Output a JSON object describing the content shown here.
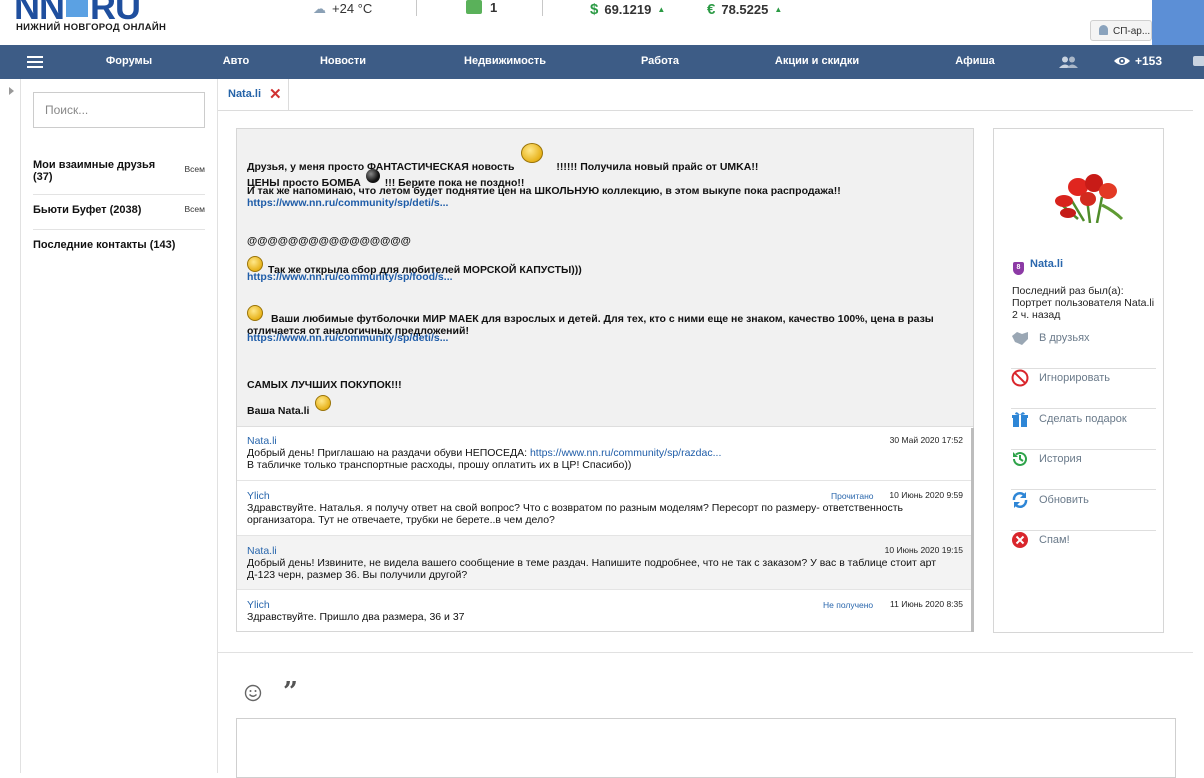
{
  "header": {
    "logo_main": "NN",
    "logo_tld": "RU",
    "logo_sub": "НИЖНИЙ НОВГОРОД ОНЛАЙН",
    "weather": "+24 °C",
    "notifications_count": "1",
    "usd": {
      "symbol": "$",
      "value": "69.1219"
    },
    "eur": {
      "symbol": "€",
      "value": "78.5225"
    },
    "user_button": "СП-ар..."
  },
  "nav": {
    "items": [
      "Форумы",
      "Авто",
      "Новости",
      "Недвижимость",
      "Работа",
      "Акции и скидки",
      "Афиша"
    ],
    "views": "+153"
  },
  "sidebar": {
    "search_placeholder": "Поиск...",
    "groups": [
      {
        "label": "Мои взаимные друзья (37)",
        "all": "Всем"
      },
      {
        "label": "Бьюти Буфет (2038)",
        "all": "Всем"
      },
      {
        "label": "Последние контакты (143)",
        "all": ""
      }
    ]
  },
  "tab": {
    "title": "Nata.li",
    "close": "✕"
  },
  "first_message": {
    "p1_a": "Друзья, у меня просто ФАНТАСТИЧЕСКАЯ новость",
    "p1_b": "!!!!!! Получила новый прайс от UMKA!!",
    "p2_a": "ЦЕНЫ просто БОМБА",
    "p2_b": "!!! Берите пока не поздно!!",
    "p3": "И так же напоминаю, что летом будет поднятие цен на ШКОЛЬНУЮ коллекцию, в этом выкупе пока распродажа!!",
    "link1": "https://www.nn.ru/community/sp/deti/s...",
    "ats": "@@@@@@@@@@@@@@@@",
    "p4": "Так же открыла сбор для любителей МОРСКОЙ КАПУСТЫ)))",
    "link2": "https://www.nn.ru/community/sp/food/s...",
    "p5": "Ваши любимые футболочки МИР МАЕК для взрослых и детей. Для тех, кто с ними еще не знаком, качество 100%, цена в разы отличается от аналогичных предложений!",
    "link3": "https://www.nn.ru/community/sp/deti/s...",
    "p6": "САМЫХ ЛУЧШИХ ПОКУПОК!!!",
    "p7": "Ваша Nata.li"
  },
  "replies": [
    {
      "author": "Nata.li",
      "status": "",
      "date": "30 Май 2020 17:52",
      "text_a": "Добрый день! Приглашаю на раздачи обуви НЕПОСЕДА: ",
      "link": "https://www.nn.ru/community/sp/razdac...",
      "text_b": "В табличке только транспортные расходы, прошу оплатить их в ЦР! Спасибо))"
    },
    {
      "author": "Ylich",
      "status": "Прочитано",
      "date": "10 Июнь 2020 9:59",
      "text_a": "Здравствуйте. Наталья. я получу ответ на свой вопрос? Что с возвратом по разным моделям? Пересорт по размеру- ответственность организатора. Тут не отвечаете, трубки не берете..в чем дело?",
      "link": "",
      "text_b": ""
    },
    {
      "author": "Nata.li",
      "status": "",
      "date": "10 Июнь 2020 19:15",
      "text_a": "Добрый день! Извините, не видела вашего сообщение в теме раздач. Напишите подробнее, что не так с заказом? У вас в таблице стоит арт Д-123 черн, размер 36. Вы получили другой?",
      "link": "",
      "text_b": ""
    },
    {
      "author": "Ylich",
      "status": "Не получено",
      "date": "11 Июнь 2020 8:35",
      "text_a": "Здравствуйте. Пришло два размера, 36 и 37",
      "link": "",
      "text_b": ""
    }
  ],
  "profile": {
    "name": "Nata.li",
    "shield_letter": "8",
    "last_seen": "Последний раз был(а): Портрет пользователя Nata.li 2 ч. назад",
    "actions": [
      {
        "label": "В друзьях",
        "icon": "handshake-icon",
        "color": "#9aa7b4"
      },
      {
        "label": "Игнорировать",
        "icon": "block-icon",
        "color": "#d9262c"
      },
      {
        "label": "Сделать подарок",
        "icon": "gift-icon",
        "color": "#2e86d6"
      },
      {
        "label": "История",
        "icon": "history-icon",
        "color": "#2ea34a"
      },
      {
        "label": "Обновить",
        "icon": "refresh-icon",
        "color": "#2e86d6"
      },
      {
        "label": "Спам!",
        "icon": "spam-icon",
        "color": "#d9262c"
      }
    ]
  },
  "composer": {
    "quote": "”"
  }
}
